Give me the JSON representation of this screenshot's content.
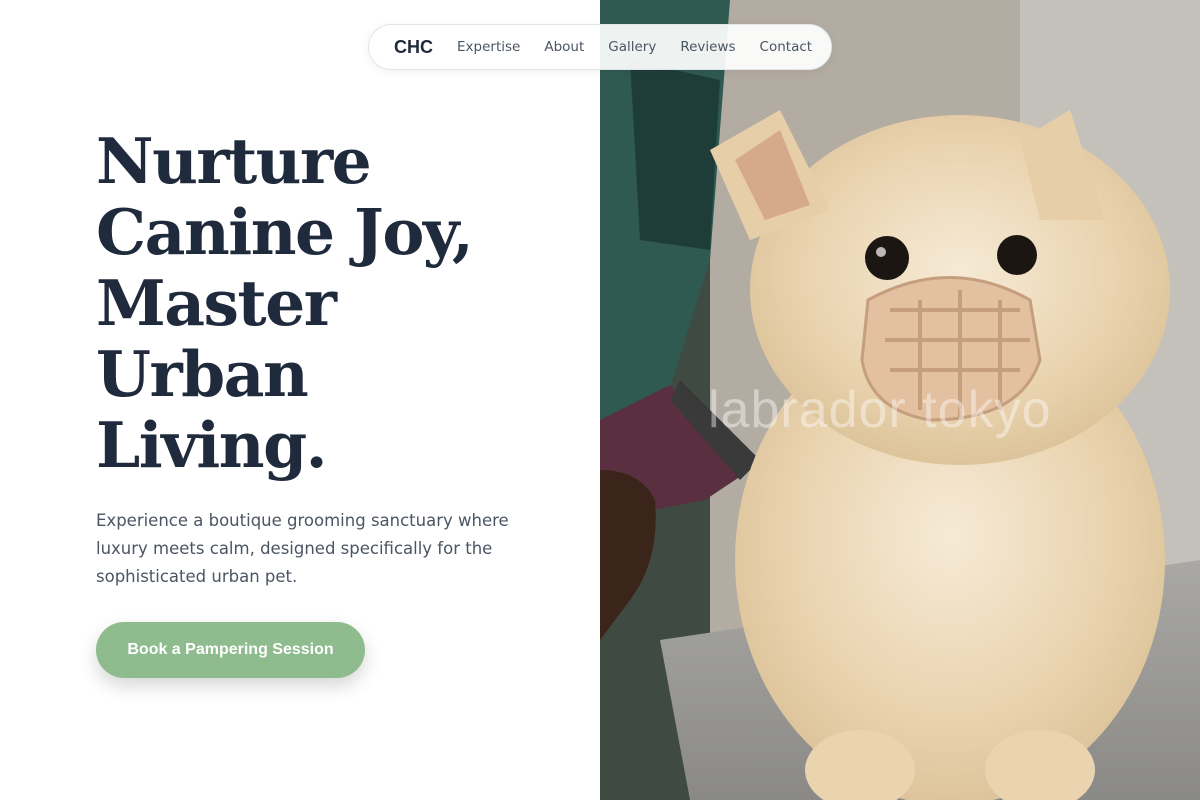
{
  "nav": {
    "brand": "CHC",
    "links": [
      "Expertise",
      "About",
      "Gallery",
      "Reviews",
      "Contact"
    ]
  },
  "hero": {
    "headline_lines": [
      "Nurture",
      "Canine Joy,",
      "Master",
      "Urban",
      "Living."
    ],
    "subtext": "Experience a boutique grooming sanctuary where luxury meets calm, designed specifically for the sophisticated urban pet.",
    "cta_label": "Book a Pampering Session"
  },
  "photo": {
    "watermark": "labrador tokyo"
  },
  "colors": {
    "heading": "#1f2a3c",
    "body_text": "#4b5563",
    "accent": "#8fbc8f",
    "background": "#ffffff"
  }
}
